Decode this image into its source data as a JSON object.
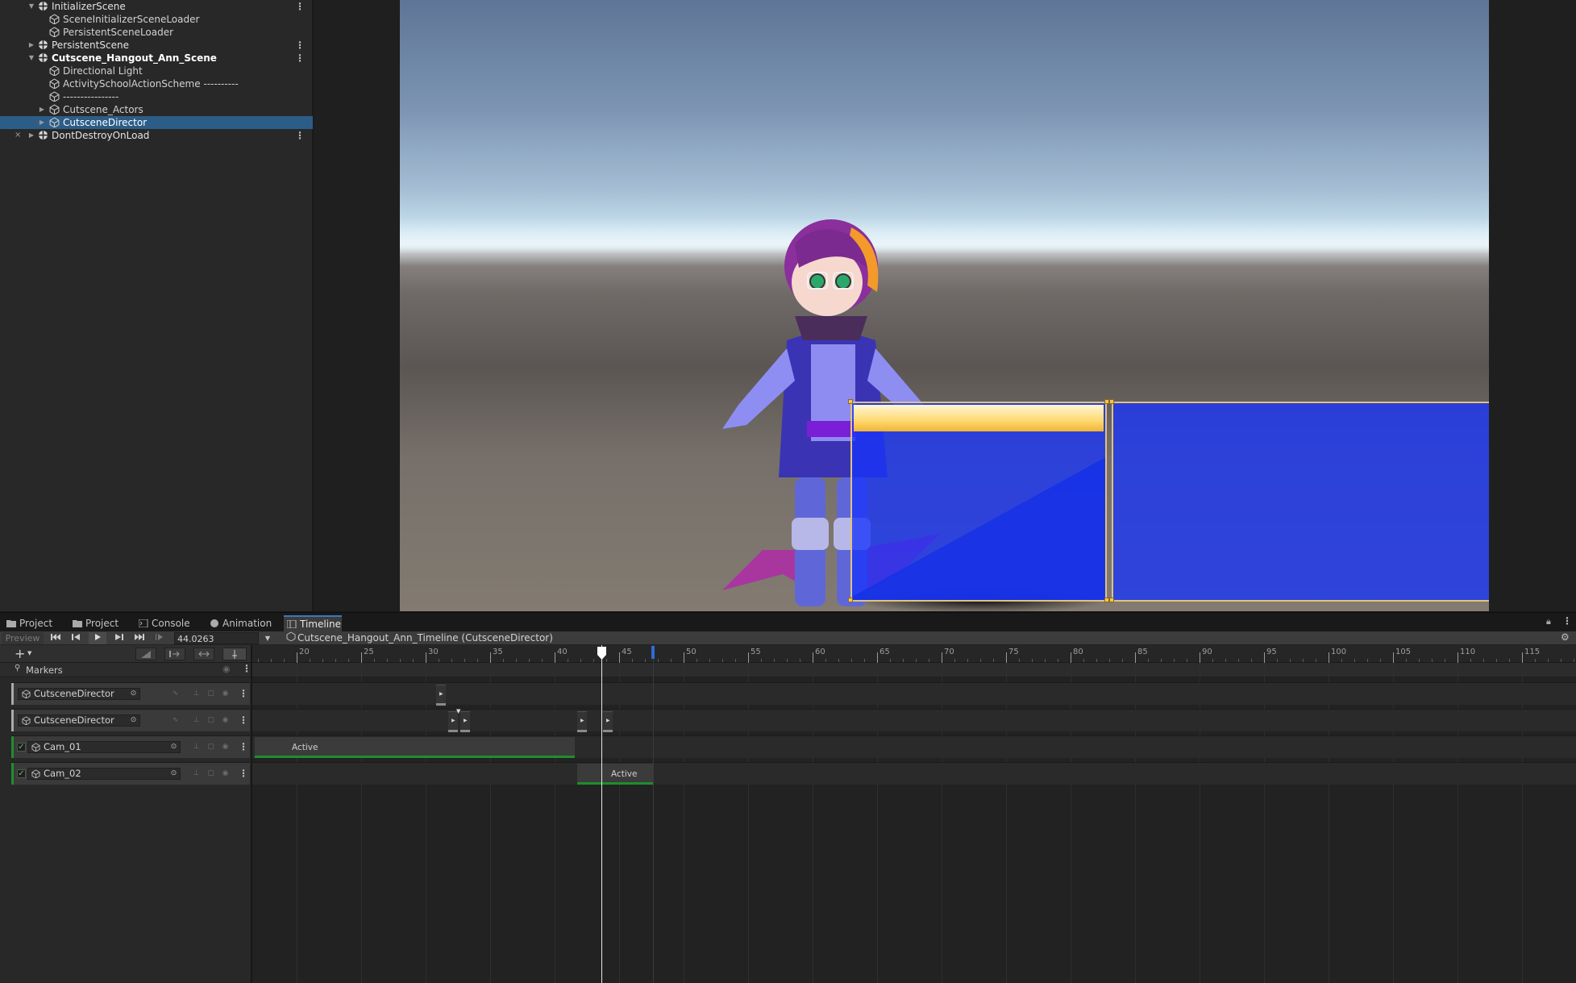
{
  "hierarchy": {
    "items": [
      {
        "label": "InitializerScene",
        "kind": "scene",
        "expanded": true,
        "kebab": true
      },
      {
        "label": "SceneInitializerSceneLoader",
        "kind": "object"
      },
      {
        "label": "PersistentSceneLoader",
        "kind": "object"
      },
      {
        "label": "PersistentScene",
        "kind": "scene",
        "expanded": false,
        "kebab": true
      },
      {
        "label": "Cutscene_Hangout_Ann_Scene",
        "kind": "scene",
        "expanded": true,
        "kebab": true
      },
      {
        "label": "Directional Light",
        "kind": "object"
      },
      {
        "label": "ActivitySchoolActionScheme ----------",
        "kind": "object"
      },
      {
        "label": "----------------",
        "kind": "object"
      },
      {
        "label": "Cutscene_Actors",
        "kind": "object",
        "expanded": false
      },
      {
        "label": "CutsceneDirector",
        "kind": "object",
        "expanded": false,
        "selected": true
      },
      {
        "label": "DontDestroyOnLoad",
        "kind": "scene",
        "expanded": false,
        "kebab": true
      }
    ],
    "kebab_glyph": "⋮"
  },
  "tabs": [
    {
      "label": "Project",
      "icon": "folder-icon"
    },
    {
      "label": "Project",
      "icon": "folder-icon"
    },
    {
      "label": "Console",
      "icon": "console-icon"
    },
    {
      "label": "Animation",
      "icon": "animation-icon"
    },
    {
      "label": "Timeline",
      "icon": "timeline-icon",
      "active": true
    }
  ],
  "timeline": {
    "preview_label": "Preview",
    "current_time": "44.0263",
    "asset_path": "Cutscene_Hangout_Ann_Timeline (CutsceneDirector)",
    "markers_label": "Markers",
    "add_button": "+",
    "ruler": {
      "labels": [
        "20",
        "25",
        "30",
        "35",
        "40",
        "45",
        "50",
        "55",
        "60",
        "65",
        "70",
        "75",
        "80",
        "85",
        "90",
        "95",
        "100",
        "105",
        "110",
        "115"
      ]
    },
    "tracks": [
      {
        "name": "CutsceneDirector",
        "type": "control",
        "color": "#9a9a9a"
      },
      {
        "name": "CutsceneDirector",
        "type": "control",
        "color": "#9a9a9a"
      },
      {
        "name": "Cam_01",
        "type": "activation",
        "color": "#1e8e2c",
        "clip_label": "Active"
      },
      {
        "name": "Cam_02",
        "type": "activation",
        "color": "#1e8e2c",
        "clip_label": "Active"
      }
    ]
  },
  "colors": {
    "selection": "#2c5d87",
    "activation_track": "#1e8e2c",
    "ui_panel_fill": "#1834f8",
    "ui_panel_border": "#e0c37a",
    "name_bar": "#ffd970"
  }
}
